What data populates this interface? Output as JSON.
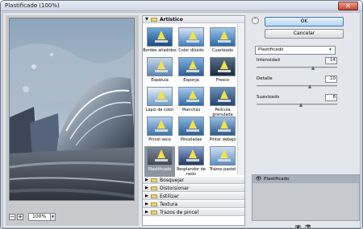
{
  "window": {
    "title": "Plastificado (100%)",
    "close_glyph": "✕"
  },
  "preview": {
    "zoom_value": "100%",
    "zoom_out_glyph": "−",
    "zoom_in_glyph": "+",
    "dropdown_glyph": "▾"
  },
  "gallery": {
    "expanded_category": "Artístico",
    "filters": [
      {
        "label": "Bordes añadidos"
      },
      {
        "label": "Color diluido"
      },
      {
        "label": "Cuarteado"
      },
      {
        "label": "Espátula"
      },
      {
        "label": "Esponja"
      },
      {
        "label": "Fresco"
      },
      {
        "label": "Lápiz de color"
      },
      {
        "label": "Manchas"
      },
      {
        "label": "Película granulada"
      },
      {
        "label": "Pincel seco"
      },
      {
        "label": "Pinceladas"
      },
      {
        "label": "Pintar debajo"
      },
      {
        "label": "Plastificado"
      },
      {
        "label": "Resplandor de neón"
      },
      {
        "label": "Trazos pastel"
      }
    ],
    "selected_filter": "Plastificado",
    "collapsed_categories": [
      "Bosquejar",
      "Distorsionar",
      "Estilizar",
      "Textura",
      "Trazos de pincel"
    ]
  },
  "controls": {
    "ok_label": "OK",
    "cancel_label": "Cancelar",
    "collapse_glyph": "⌃",
    "filter_select_value": "Plastificado",
    "filter_select_arrow": "▾",
    "params": [
      {
        "label": "Intensidad",
        "value": "14",
        "fraction": 0.7
      },
      {
        "label": "Detalle",
        "value": "10",
        "fraction": 0.66
      },
      {
        "label": "Suavizado",
        "value": "8",
        "fraction": 0.55
      }
    ]
  },
  "layers": {
    "items": [
      {
        "name": "Plastificado"
      }
    ],
    "eye_glyph": "👁",
    "new_layer_glyph": "▣",
    "delete_layer_glyph": "🗑"
  },
  "colors": {
    "accent_ok_border": "#3b79b6",
    "selected_thumb": "#8c95a0"
  }
}
